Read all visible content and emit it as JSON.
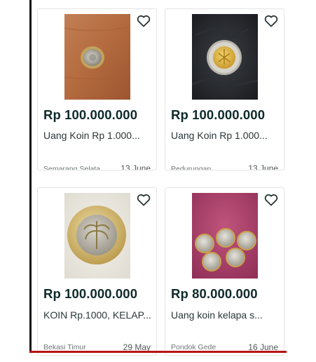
{
  "listings": [
    {
      "price": "Rp 100.000.000",
      "title": "Uang Koin Rp 1.000...",
      "location": "Semarang Selata...",
      "date": "13 June",
      "photo_icon": "coin-on-wood-photo"
    },
    {
      "price": "Rp 100.000.000",
      "title": "Uang Koin Rp 1.000...",
      "location": "Pedurungan",
      "date": "13 June",
      "photo_icon": "coin-on-leather-photo"
    },
    {
      "price": "Rp 100.000.000",
      "title": "KOIN Rp.1000, KELAP...",
      "location": "Bekasi Timur",
      "date": "29 May",
      "photo_icon": "bimetal-coin-photo"
    },
    {
      "price": "Rp 80.000.000",
      "title": "Uang koin kelapa s...",
      "location": "Pondok Gede",
      "date": "16 June",
      "photo_icon": "five-coins-photo"
    }
  ],
  "colors": {
    "price_text": "#0f2a2a",
    "meta_text": "#6d7676",
    "card_border": "#e4e4e4"
  }
}
